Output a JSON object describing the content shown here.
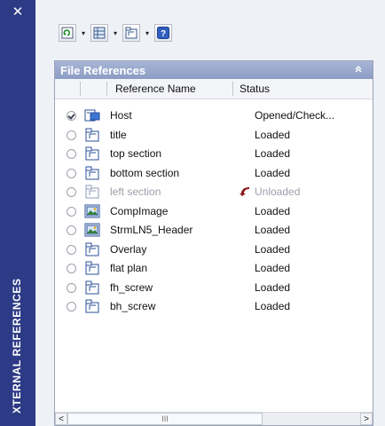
{
  "palette": {
    "side_strip": "#2d3a86",
    "panel_header": "#8c9cc4",
    "unload_arrow": "#8b1a1a"
  },
  "window": {
    "close_label": "✕",
    "title": "XTERNAL REFERENCES"
  },
  "toolbar": {
    "icons": [
      "refresh-icon",
      "table-view-icon",
      "attach-icon",
      "help-icon"
    ],
    "help_label": "?"
  },
  "panel": {
    "title": "File References",
    "collapse_glyph": "⌃"
  },
  "columns": {
    "name": "Reference Name",
    "status": "Status"
  },
  "rows": [
    {
      "name": "Host",
      "status": "Opened/Check...",
      "selected": true,
      "icon": "host-drawing-icon",
      "muted": false,
      "unloaded": false
    },
    {
      "name": "title",
      "status": "Loaded",
      "selected": false,
      "icon": "xref-drawing-icon",
      "muted": false,
      "unloaded": false
    },
    {
      "name": "top section",
      "status": "Loaded",
      "selected": false,
      "icon": "xref-drawing-icon",
      "muted": false,
      "unloaded": false
    },
    {
      "name": "bottom section",
      "status": "Loaded",
      "selected": false,
      "icon": "xref-drawing-icon",
      "muted": false,
      "unloaded": false
    },
    {
      "name": "left section",
      "status": "Unloaded",
      "selected": false,
      "icon": "xref-drawing-icon",
      "muted": true,
      "unloaded": true
    },
    {
      "name": "CompImage",
      "status": "Loaded",
      "selected": false,
      "icon": "raster-image-icon",
      "muted": false,
      "unloaded": false
    },
    {
      "name": "StrmLN5_Header",
      "status": "Loaded",
      "selected": false,
      "icon": "raster-image-icon",
      "muted": false,
      "unloaded": false
    },
    {
      "name": "Overlay",
      "status": "Loaded",
      "selected": false,
      "icon": "xref-drawing-icon",
      "muted": false,
      "unloaded": false
    },
    {
      "name": "flat plan",
      "status": "Loaded",
      "selected": false,
      "icon": "xref-drawing-icon",
      "muted": false,
      "unloaded": false
    },
    {
      "name": "fh_screw",
      "status": "Loaded",
      "selected": false,
      "icon": "xref-drawing-icon",
      "muted": false,
      "unloaded": false
    },
    {
      "name": "bh_screw",
      "status": "Loaded",
      "selected": false,
      "icon": "xref-drawing-icon",
      "muted": false,
      "unloaded": false
    }
  ],
  "scrollbar": {
    "left_glyph": "<",
    "right_glyph": ">",
    "thumb_glyph": "III"
  }
}
